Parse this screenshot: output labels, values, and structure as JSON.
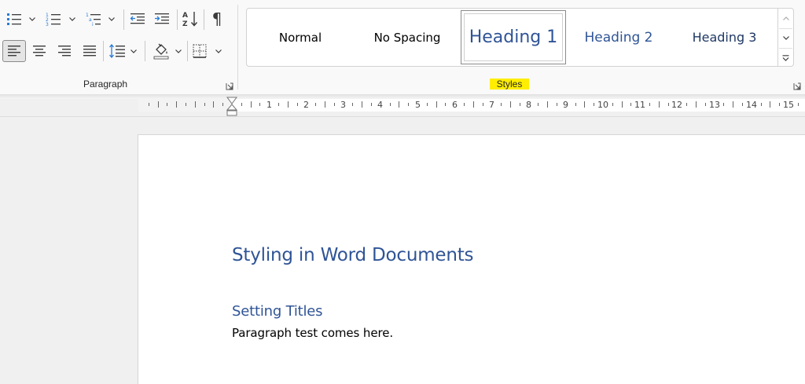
{
  "ribbon": {
    "paragraph_group": {
      "label": "Paragraph",
      "buttons": [
        {
          "name": "bullets",
          "icon": "bullet-list-icon"
        },
        {
          "name": "numbering",
          "icon": "numbered-list-icon"
        },
        {
          "name": "multilevel-list",
          "icon": "multilevel-list-icon"
        },
        {
          "name": "decrease-indent",
          "icon": "decrease-indent-icon"
        },
        {
          "name": "increase-indent",
          "icon": "increase-indent-icon"
        },
        {
          "name": "sort",
          "icon": "sort-az-icon"
        },
        {
          "name": "show-hide-marks",
          "icon": "pilcrow-icon",
          "glyph": "¶"
        },
        {
          "name": "align-left",
          "icon": "align-left-icon",
          "active": true
        },
        {
          "name": "center",
          "icon": "align-center-icon"
        },
        {
          "name": "align-right",
          "icon": "align-right-icon"
        },
        {
          "name": "justify",
          "icon": "justify-icon"
        },
        {
          "name": "line-spacing",
          "icon": "line-spacing-icon"
        },
        {
          "name": "shading",
          "icon": "paint-bucket-icon"
        },
        {
          "name": "borders",
          "icon": "borders-icon"
        }
      ]
    },
    "styles_group": {
      "label": "Styles",
      "items": [
        {
          "label": "Normal",
          "selected": false
        },
        {
          "label": "No Spacing",
          "selected": false
        },
        {
          "label": "Heading 1",
          "selected": true
        },
        {
          "label": "Heading 2",
          "selected": false
        },
        {
          "label": "Heading 3",
          "selected": false
        }
      ]
    }
  },
  "ruler": {
    "numbers": [
      "1",
      "2",
      "3",
      "4",
      "5",
      "6",
      "7",
      "8",
      "9",
      "10",
      "11",
      "12",
      "13",
      "14",
      "15"
    ]
  },
  "document": {
    "title": "Styling in Word Documents",
    "heading2": "Setting Titles",
    "paragraph": "Paragraph test comes here."
  },
  "colors": {
    "heading": "#2f5496",
    "style_highlight": "#ffee00",
    "active_button": "#e5e5e5"
  }
}
